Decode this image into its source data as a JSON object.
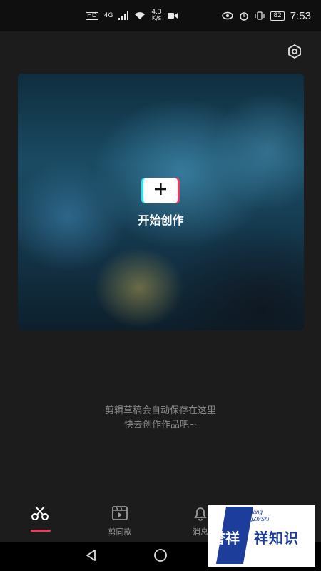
{
  "status_bar": {
    "badge_hd": "HD",
    "badge_4g": "4G",
    "speed_value": "4.3",
    "speed_unit": "K/s",
    "battery": "82",
    "time": "7:53"
  },
  "main": {
    "create_label": "开始创作",
    "hint_line1": "剪辑草稿会自动保存在这里",
    "hint_line2": "快去创作作品吧~"
  },
  "tabs": [
    {
      "label": "",
      "icon": "scissors-icon",
      "active": true
    },
    {
      "label": "剪同款",
      "icon": "template-video-icon",
      "active": false
    },
    {
      "label": "消息",
      "icon": "bell-icon",
      "active": false
    }
  ],
  "colors": {
    "accent_red": "#f0385a",
    "accent_cyan": "#2fe3ea",
    "background": "#1c1c1c",
    "watermark_blue": "#1d3d9a"
  },
  "watermark": {
    "en_line1": "YuXiang",
    "en_line2": "XiangZhiShi",
    "cn_left": "誉祥",
    "cn_right": "祥知识"
  }
}
